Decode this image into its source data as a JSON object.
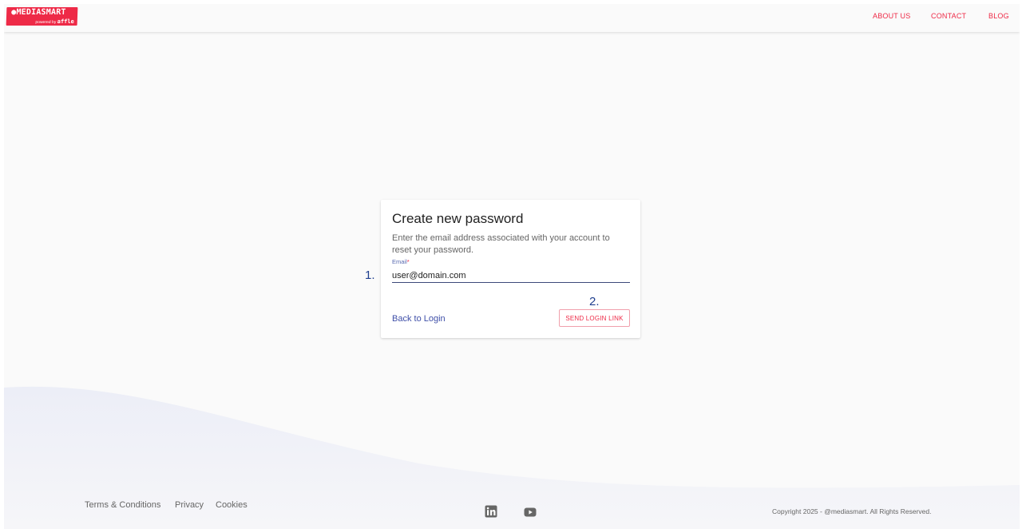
{
  "header": {
    "logo": {
      "brand": "MEDIASMART",
      "tagline_prefix": "powered by",
      "tagline_brand": "affle"
    },
    "nav": {
      "about": "ABOUT US",
      "contact": "CONTACT",
      "blog": "BLOG"
    }
  },
  "card": {
    "title": "Create new password",
    "description": "Enter the email address associated with your account to reset your password.",
    "email_label": "Email",
    "required_marker": "*",
    "email_value": "user@domain.com",
    "back_link": "Back to Login",
    "send_button": "SEND LOGIN LINK"
  },
  "annotations": {
    "step1": "1.",
    "step2": "2."
  },
  "footer": {
    "terms": "Terms & Conditions",
    "privacy": "Privacy",
    "cookies": "Cookies",
    "social": [
      "linkedin-icon",
      "youtube-icon"
    ],
    "copyright": "Copyright 2025 - @mediasmart. All Rights Reserved."
  },
  "colors": {
    "brand_red": "#ee2a47",
    "link_blue": "#3f4fa8",
    "step_blue": "#1f3f8f",
    "background": "#fafafa",
    "wave": "#eceef7"
  }
}
